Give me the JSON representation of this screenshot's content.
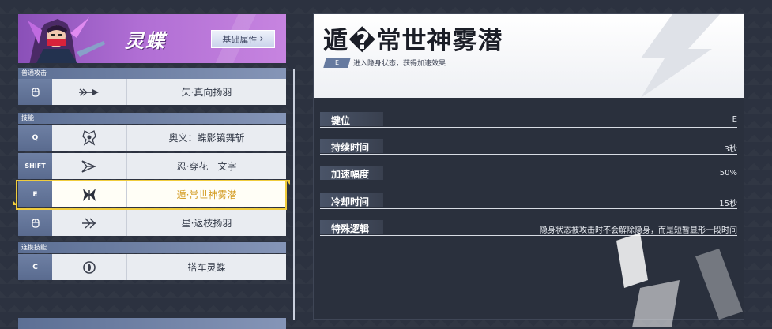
{
  "character": {
    "name": "灵蝶",
    "basic_attr_label": "基础属性",
    "basic_attr_arrow": "›"
  },
  "sections": {
    "normal_attack": "普通攻击",
    "skills": "技能",
    "combo_skills": "连携技能"
  },
  "skills": [
    {
      "key_icon": "mouse-icon",
      "name": "矢·真向扬羽"
    },
    {
      "key": "Q",
      "name": "奥义：蝶影镜舞斩"
    },
    {
      "key": "SHIFT",
      "name": "忍·穿花一文字"
    },
    {
      "key": "E",
      "name": "遁·常世神雾潜"
    },
    {
      "key_icon": "mouse-icon",
      "name": "星·返枝扬羽"
    },
    {
      "key": "C",
      "name": "搭车灵蝶"
    }
  ],
  "detail": {
    "title": "遁�常世神雾潜",
    "key": "E",
    "description": "进入隐身状态，获得加速效果",
    "stats": [
      {
        "label": "键位",
        "value": "E"
      },
      {
        "label": "持续时间",
        "value": "3秒"
      },
      {
        "label": "加速幅度",
        "value": "50%"
      },
      {
        "label": "冷却时间",
        "value": "15秒"
      },
      {
        "label": "特殊逻辑",
        "value": "隐身状态被攻击时不会解除隐身，而是短暂显形一段时间"
      }
    ]
  },
  "colors": {
    "accent_purple": "#b06ed4",
    "selected_gold": "#f0cc3c",
    "key_blue": "#667a9f",
    "panel_dark": "#2a303d"
  }
}
